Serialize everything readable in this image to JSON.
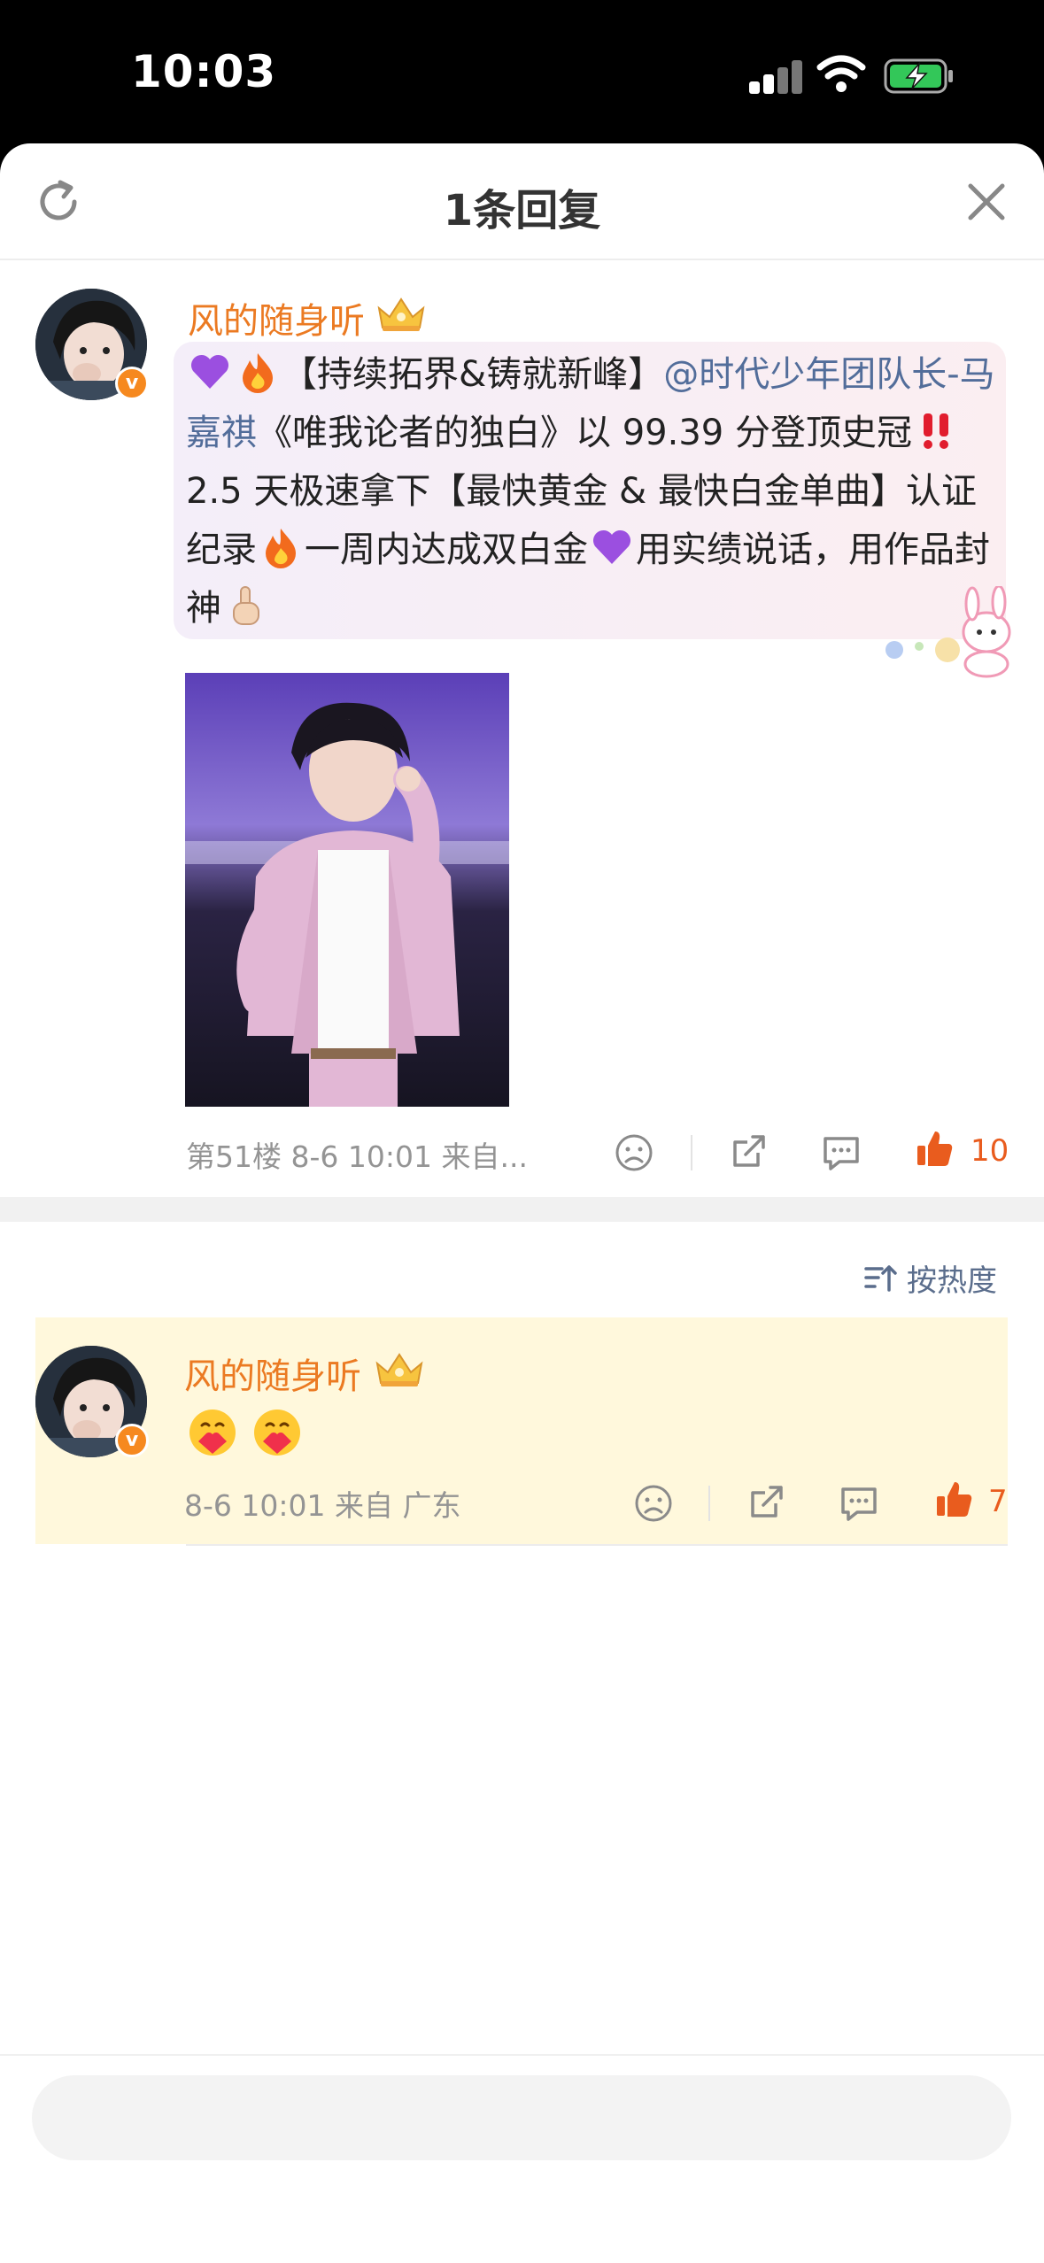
{
  "status_bar": {
    "time": "10:03"
  },
  "sheet": {
    "title": "1条回复"
  },
  "post": {
    "username": "风的随身听",
    "text_parts": {
      "p1": "【持续拓界&铸就新峰】",
      "mention": "@时代少年团队长-马嘉祺",
      "p2": "《唯我论者的独白》以 99.39 分登顶史冠",
      "p3": "2.5 天极速拿下【最快黄金 & 最快白金单曲】认证纪录",
      "p4": "一周内达成双白金",
      "p5": "用实绩说话，用作品封神"
    },
    "meta": "第51楼  8-6 10:01  来自...",
    "like_count": "10",
    "emoji_icons": [
      "purple-heart-icon",
      "fire-icon",
      "double-exclamation-icon",
      "fire-icon",
      "purple-heart-icon",
      "pointing-up-icon"
    ]
  },
  "sort": {
    "label": "按热度"
  },
  "reply": {
    "username": "风的随身听",
    "emoji_icons": [
      "heart-face-icon",
      "heart-face-icon"
    ],
    "meta": "8-6 10:01  来自 广东",
    "like_count": "7"
  },
  "colors": {
    "username": "#eb7a22",
    "mention": "#526d9a",
    "like": "#e95c1e",
    "highlight_bg": "#fff8dc",
    "bubble_bg": "#f7eef5",
    "verified_badge": "#f6891f"
  }
}
